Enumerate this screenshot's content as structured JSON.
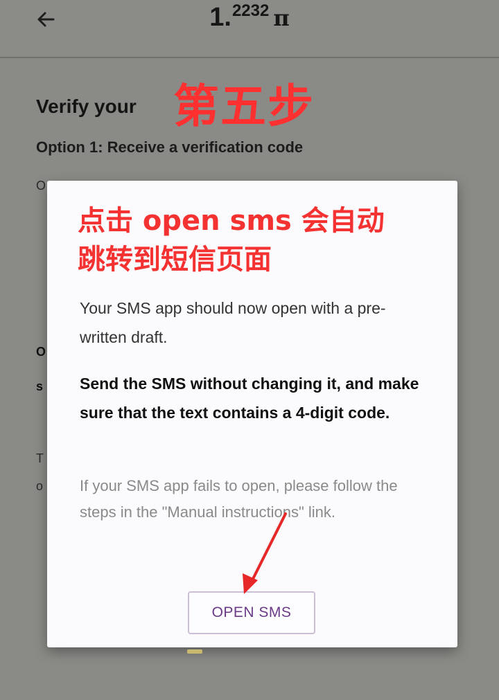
{
  "header": {
    "back_icon": "arrow-left-icon",
    "balance_int": "1.",
    "balance_frac": "2232",
    "balance_unit": "π"
  },
  "background": {
    "heading": "Verify your",
    "option1": "Option 1: Receive a verification code",
    "peek_1": "O",
    "peek_2": "O",
    "peek_3": "s",
    "peek_4": "T",
    "peek_5": "o"
  },
  "annotation": {
    "step_title": "第五步",
    "line1": "点击 open sms 会自动",
    "line2": "跳转到短信页面",
    "color": "#f43232"
  },
  "dialog": {
    "paragraph1": "Your SMS app should now open with a pre-written draft.",
    "paragraph2": "Send the SMS without changing it, and make sure that the text contains a 4-digit code.",
    "paragraph3": "If your SMS app fails to open, please follow the steps in the \"Manual instructions\" link.",
    "open_button": "OPEN SMS",
    "button_color": "#6a3a86"
  }
}
